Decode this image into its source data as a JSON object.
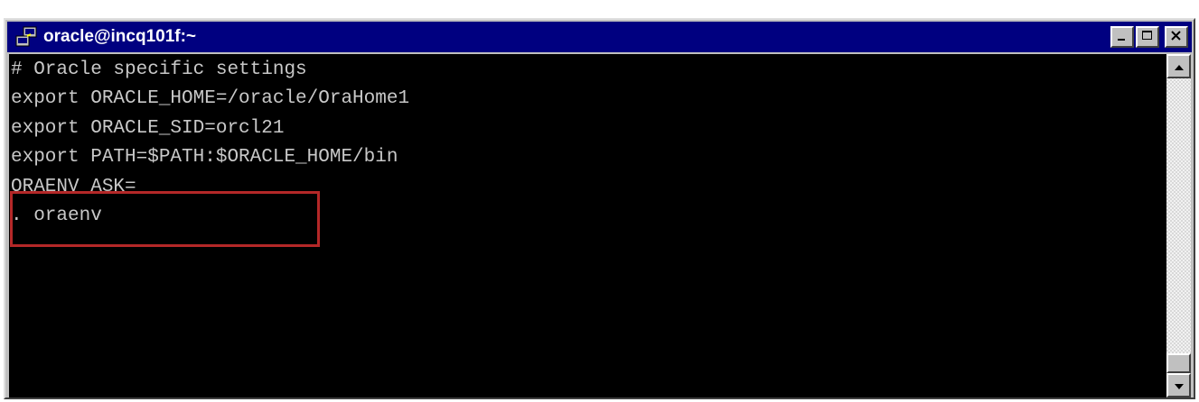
{
  "window": {
    "title": "oracle@incq101f:~",
    "icon": "putty-terminal-icon",
    "controls": [
      "minimize",
      "maximize",
      "close"
    ]
  },
  "terminal": {
    "lines": [
      "# Oracle specific settings",
      "export ORACLE_HOME=/oracle/OraHome1",
      "export ORACLE_SID=orcl21",
      "export PATH=$PATH:$ORACLE_HOME/bin",
      "ORAENV_ASK=",
      ". oraenv"
    ],
    "text_color": "#c8c8c8",
    "background_color": "#000000"
  },
  "highlight": {
    "color": "#b42828",
    "covers_lines": [
      "ORAENV_ASK=",
      ". oraenv"
    ]
  },
  "colors": {
    "titlebar": "#000080",
    "chrome": "#c0c0c0"
  }
}
